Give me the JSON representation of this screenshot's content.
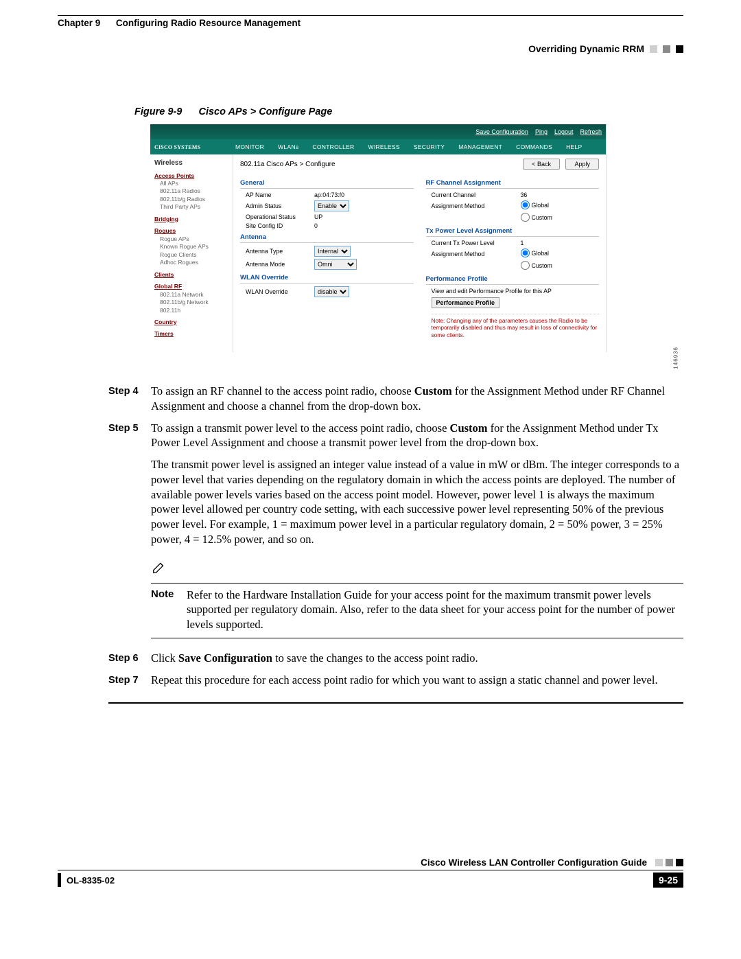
{
  "header": {
    "chapter": "Chapter 9",
    "chapter_sep": "    ",
    "chapter_title": "Configuring Radio Resource Management",
    "section": "Overriding Dynamic RRM"
  },
  "figure": {
    "label": "Figure 9-9",
    "title": "Cisco APs > Configure Page"
  },
  "ui": {
    "toplinks": {
      "save": "Save Configuration",
      "ping": "Ping",
      "logout": "Logout",
      "refresh": "Refresh"
    },
    "logo": "CISCO SYSTEMS",
    "tabs": {
      "monitor": "MONITOR",
      "wlans": "WLANs",
      "controller": "CONTROLLER",
      "wireless": "WIRELESS",
      "security": "SECURITY",
      "management": "MANAGEMENT",
      "commands": "COMMANDS",
      "help": "HELP"
    },
    "sidebar": {
      "title": "Wireless",
      "ap_group": "Access Points",
      "ap_all": "All APs",
      "ap_a": "802.11a Radios",
      "ap_bg": "802.11b/g Radios",
      "ap_tp": "Third Party APs",
      "bridging": "Bridging",
      "rogues": "Rogues",
      "rogue_aps": "Rogue APs",
      "known_rogue": "Known Rogue APs",
      "rogue_clients": "Rogue Clients",
      "adhoc": "Adhoc Rogues",
      "clients": "Clients",
      "global": "Global RF",
      "g_a": "802.11a Network",
      "g_bg": "802.11b/g Network",
      "g_h": "802.11h",
      "country": "Country",
      "timers": "Timers"
    },
    "crumb": "802.11a Cisco APs > Configure",
    "back": "< Back",
    "apply": "Apply",
    "general": {
      "title": "General",
      "apname_k": "AP Name",
      "apname_v": "ap:04:73:f0",
      "admin_k": "Admin Status",
      "opstat_k": "Operational Status",
      "opstat_v": "UP",
      "scfg_k": "Site Config ID",
      "scfg_v": "0"
    },
    "antenna": {
      "title": "Antenna",
      "type_k": "Antenna Type",
      "mode_k": "Antenna Mode"
    },
    "wlanov": {
      "title": "WLAN Override",
      "k": "WLAN Override"
    },
    "rfchan": {
      "title": "RF Channel Assignment",
      "cur_k": "Current Channel",
      "cur_v": "36",
      "meth_k": "Assignment Method",
      "global": "Global",
      "custom": "Custom"
    },
    "txpow": {
      "title": "Tx Power Level Assignment",
      "cur_k": "Current Tx Power Level",
      "cur_v": "1",
      "meth_k": "Assignment Method",
      "global": "Global",
      "custom": "Custom"
    },
    "perf": {
      "title": "Performance Profile",
      "desc": "View and edit Performance Profile for this AP",
      "btn": "Performance Profile"
    },
    "note": "Note: Changing any of the parameters causes the Radio to be temporarily disabled and thus may result in loss of connectivity for some clients.",
    "sidenum": "146936",
    "sel": {
      "enable": "Enable",
      "internal": "Internal",
      "omni": "Omni",
      "disable": "disable"
    }
  },
  "steps": {
    "s4_label": "Step 4",
    "s4_a": "To assign an RF channel to the access point radio, choose ",
    "s4_b": "Custom",
    "s4_c": " for the Assignment Method under RF Channel Assignment and choose a channel from the drop-down box.",
    "s5_label": "Step 5",
    "s5_a": "To assign a transmit power level to the access point radio, choose ",
    "s5_b": "Custom",
    "s5_c": " for the Assignment Method under Tx Power Level Assignment and choose a transmit power level from the drop-down box.",
    "p1": "The transmit power level is assigned an integer value instead of a value in mW or dBm. The integer corresponds to a power level that varies depending on the regulatory domain in which the access points are deployed. The number of available power levels varies based on the access point model. However, power level 1 is always the maximum power level allowed per country code setting, with each successive power level representing 50% of the previous power level. For example, 1 = maximum power level in a particular regulatory domain, 2 = 50% power, 3 = 25% power, 4 = 12.5% power, and so on.",
    "note_label": "Note",
    "note_body": "Refer to the Hardware Installation Guide for your access point for the maximum transmit power levels supported per regulatory domain. Also, refer to the data sheet for your access point for the number of power levels supported.",
    "s6_label": "Step 6",
    "s6_a": "Click ",
    "s6_b": "Save Configuration",
    "s6_c": " to save the changes to the access point radio.",
    "s7_label": "Step 7",
    "s7": "Repeat this procedure for each access point radio for which you want to assign a static channel and power level."
  },
  "footer": {
    "guide": "Cisco Wireless LAN Controller Configuration Guide",
    "docnum": "OL-8335-02",
    "pagenum": "9-25"
  }
}
